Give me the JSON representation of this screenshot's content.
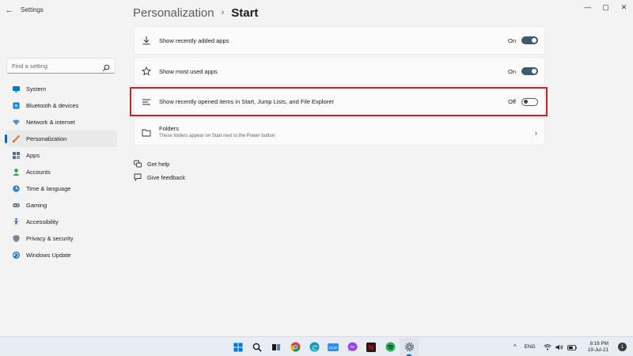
{
  "window": {
    "app_title": "Settings",
    "back_glyph": "←",
    "minimize_glyph": "—",
    "maximize_glyph": "▢",
    "close_glyph": "✕"
  },
  "search": {
    "placeholder": "Find a setting",
    "icon": "search-icon"
  },
  "sidebar": {
    "items": [
      {
        "label": "System",
        "icon": "system-icon",
        "color": "#0078d4"
      },
      {
        "label": "Bluetooth & devices",
        "icon": "bluetooth-icon",
        "color": "#0078d4"
      },
      {
        "label": "Network & internet",
        "icon": "network-icon",
        "color": "#4a8fd8"
      },
      {
        "label": "Personalization",
        "icon": "brush-icon",
        "color": "#e07a2c",
        "selected": true
      },
      {
        "label": "Apps",
        "icon": "apps-icon",
        "color": "#5a6e8c"
      },
      {
        "label": "Accounts",
        "icon": "accounts-icon",
        "color": "#2ba34a"
      },
      {
        "label": "Time & language",
        "icon": "time-language-icon",
        "color": "#2a8ad4"
      },
      {
        "label": "Gaming",
        "icon": "gaming-icon",
        "color": "#6b7a8c"
      },
      {
        "label": "Accessibility",
        "icon": "accessibility-icon",
        "color": "#1f6fc5"
      },
      {
        "label": "Privacy & security",
        "icon": "shield-icon",
        "color": "#7b8490"
      },
      {
        "label": "Windows Update",
        "icon": "windows-update-icon",
        "color": "#1f6fc5"
      }
    ]
  },
  "header": {
    "parent": "Personalization",
    "separator": "›",
    "current": "Start"
  },
  "settings": [
    {
      "label": "Show recently added apps",
      "icon": "download-icon",
      "state": "On",
      "on": true
    },
    {
      "label": "Show most used apps",
      "icon": "star-icon",
      "state": "On",
      "on": true
    },
    {
      "label": "Show recently opened items in Start, Jump Lists, and File Explorer",
      "icon": "list-icon",
      "state": "Off",
      "on": false,
      "highlighted": true
    }
  ],
  "folders": {
    "title": "Folders",
    "subtitle": "These folders appear on Start next to the Power button",
    "chevron": "›"
  },
  "links": [
    {
      "label": "Get help",
      "icon": "help-icon"
    },
    {
      "label": "Give feedback",
      "icon": "feedback-icon"
    }
  ],
  "colors": {
    "accent": "#0067c0",
    "toggle_on": "#3c5a72",
    "highlight": "#d11f24"
  },
  "taskbar": {
    "apps": [
      "windows-start-icon",
      "search-icon",
      "task-view-icon",
      "chrome-icon",
      "edge-icon",
      "zoom-icon",
      "messenger-icon",
      "netflix-icon",
      "spotify-icon",
      "settings-icon"
    ],
    "zoom_text": "zoom",
    "netflix_text": "N",
    "tray_chevron": "^",
    "language": "ENG",
    "time": "8:16 PM",
    "date": "19-Jul-21",
    "notifications": "1"
  }
}
